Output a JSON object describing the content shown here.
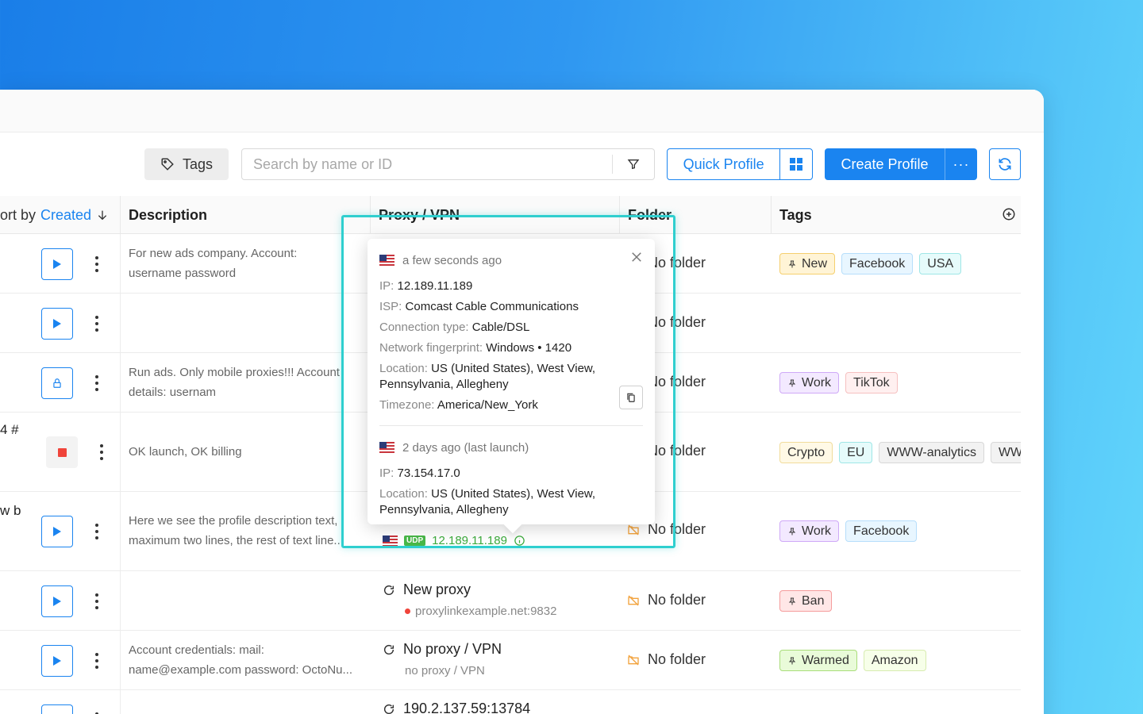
{
  "toolbar": {
    "tags_label": "Tags",
    "search_placeholder": "Search by name or ID",
    "quick_profile_label": "Quick Profile",
    "create_profile_label": "Create Profile",
    "more_label": "···"
  },
  "table": {
    "sort_prefix": "ort by",
    "sort_field": "Created",
    "headers": {
      "description": "Description",
      "proxy": "Proxy / VPN",
      "folder": "Folder",
      "tags": "Tags"
    }
  },
  "rows": [
    {
      "desc1": "For new ads company. Account:",
      "desc2": "username password",
      "folder": "No folder",
      "tags": [
        {
          "label": "New",
          "style": "yellow",
          "pin": true
        },
        {
          "label": "Facebook",
          "style": "blue",
          "pin": false
        },
        {
          "label": "USA",
          "style": "cyan",
          "pin": false
        }
      ]
    },
    {
      "desc1": "",
      "desc2": "",
      "folder": "No folder",
      "tags": []
    },
    {
      "desc1": "Run ads. Only mobile proxies!!! Account",
      "desc2": "details: usernam",
      "folder": "No folder",
      "tags": [
        {
          "label": "Work",
          "style": "purple",
          "pin": true
        },
        {
          "label": "TikTok",
          "style": "pink",
          "pin": false
        }
      ]
    },
    {
      "name_frag": "4 #",
      "desc1": "OK launch, OK billing",
      "folder": "No folder",
      "tags": [
        {
          "label": "Crypto",
          "style": "cream",
          "pin": false
        },
        {
          "label": "EU",
          "style": "cyan",
          "pin": false
        },
        {
          "label": "WWW-analytics",
          "style": "grey",
          "pin": false
        },
        {
          "label": "WWW",
          "style": "grey",
          "pin": false
        }
      ]
    },
    {
      "name_frag": "w b",
      "desc1": "Here we see the profile description text,",
      "desc2": "maximum two lines, the rest of text line...",
      "folder": "No folder",
      "tags": [
        {
          "label": "Work",
          "style": "purple",
          "pin": true
        },
        {
          "label": "Facebook",
          "style": "blue",
          "pin": false
        }
      ]
    },
    {
      "desc1": "",
      "folder": "No folder",
      "proxy1": "New proxy",
      "proxy2": "proxylinkexample.net:9832",
      "tags": [
        {
          "label": "Ban",
          "style": "red",
          "pin": true
        }
      ]
    },
    {
      "desc1": "Account credentials: mail:",
      "desc2": "name@example.com password: OctoNu...",
      "folder": "No folder",
      "proxy1": "No proxy / VPN",
      "proxy2": "no proxy / VPN",
      "tags": [
        {
          "label": "Warmed",
          "style": "green",
          "pin": true
        },
        {
          "label": "Amazon",
          "style": "lime",
          "pin": false
        }
      ]
    },
    {
      "proxy1": "190.2.137.59:13784"
    }
  ],
  "under_popover": {
    "badge": "UDP",
    "ip": "12.189.11.189"
  },
  "popover": {
    "current": {
      "time": "a few seconds ago",
      "ip_label": "IP:",
      "ip": "12.189.11.189",
      "isp_label": "ISP:",
      "isp": "Comcast Cable Communications",
      "conn_label": "Connection type:",
      "conn": "Cable/DSL",
      "fp_label": "Network fingerprint:",
      "fp": "Windows • 1420",
      "loc_label": "Location:",
      "loc": "US (United States), West View, Pennsylvania, Allegheny",
      "tz_label": "Timezone:",
      "tz": "America/New_York"
    },
    "last": {
      "time": "2 days ago (last launch)",
      "ip_label": "IP:",
      "ip": "73.154.17.0",
      "loc_label": "Location:",
      "loc": "US (United States), West View, Pennsylvania, Allegheny"
    }
  },
  "colors": {
    "accent": "#1a84f0",
    "highlight": "#2fcfcf",
    "stop": "#f0443a",
    "folder_icon": "#f2a23c"
  }
}
